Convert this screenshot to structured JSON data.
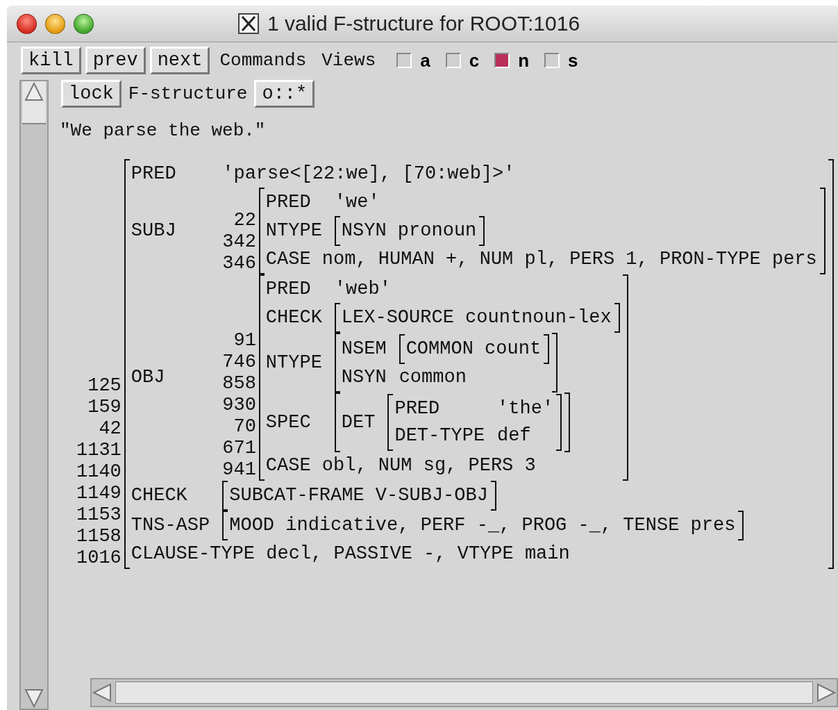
{
  "window": {
    "title": "1 valid F-structure for ROOT:1016"
  },
  "toolbar": {
    "buttons": [
      "kill",
      "prev",
      "next"
    ],
    "menus": [
      "Commands",
      "Views"
    ],
    "views": [
      {
        "label": "a",
        "checked": false
      },
      {
        "label": "c",
        "checked": false
      },
      {
        "label": "n",
        "checked": true
      },
      {
        "label": "s",
        "checked": false
      }
    ]
  },
  "panel": {
    "lock_button": "lock",
    "label": "F-structure",
    "filter_button": "o::*",
    "sentence": "\"We parse the web.\"",
    "fstructure": {
      "ids": [
        "125",
        "159",
        "42",
        "1131",
        "1140",
        "1149",
        "1153",
        "1158",
        "1016"
      ],
      "rows": [
        {
          "kind": "pair",
          "attr": "PRED",
          "value": "'parse<[22:we], [70:web]>'"
        },
        {
          "kind": "sub",
          "attr": "SUBJ",
          "avm": {
            "ids": [
              "22",
              "342",
              "346"
            ],
            "rows": [
              {
                "kind": "pair",
                "attr": "PRED",
                "value": "'we'"
              },
              {
                "kind": "sub",
                "attr": "NTYPE",
                "avm": {
                  "rows": [
                    {
                      "kind": "flat",
                      "text": "NSYN pronoun"
                    }
                  ]
                }
              },
              {
                "kind": "flat",
                "text": "CASE nom, HUMAN +, NUM pl, PERS 1, PRON-TYPE pers"
              }
            ]
          }
        },
        {
          "kind": "sub",
          "attr": "OBJ",
          "avm": {
            "ids": [
              "91",
              "746",
              "858",
              "930",
              "70",
              "671",
              "941"
            ],
            "rows": [
              {
                "kind": "pair",
                "attr": "PRED",
                "value": "'web'"
              },
              {
                "kind": "sub",
                "attr": "CHECK",
                "avm": {
                  "rows": [
                    {
                      "kind": "flat",
                      "text": "LEX-SOURCE countnoun-lex"
                    }
                  ]
                }
              },
              {
                "kind": "sub",
                "attr": "NTYPE",
                "avm": {
                  "rows": [
                    {
                      "kind": "sub",
                      "attr": "NSEM",
                      "avm": {
                        "rows": [
                          {
                            "kind": "flat",
                            "text": "COMMON count"
                          }
                        ]
                      }
                    },
                    {
                      "kind": "pair",
                      "attr": "NSYN",
                      "value": "common"
                    }
                  ]
                }
              },
              {
                "kind": "sub",
                "attr": "SPEC",
                "avm": {
                  "rows": [
                    {
                      "kind": "sub",
                      "attr": "DET",
                      "avm": {
                        "rows": [
                          {
                            "kind": "pair",
                            "attr": "PRED",
                            "value": "'the'"
                          },
                          {
                            "kind": "pair",
                            "attr": "DET-TYPE",
                            "value": "def"
                          }
                        ]
                      }
                    }
                  ]
                }
              },
              {
                "kind": "flat",
                "text": "CASE obl, NUM sg, PERS 3"
              }
            ]
          }
        },
        {
          "kind": "sub",
          "attr": "CHECK",
          "avm": {
            "rows": [
              {
                "kind": "flat",
                "text": "SUBCAT-FRAME V-SUBJ-OBJ"
              }
            ]
          }
        },
        {
          "kind": "sub",
          "attr": "TNS-ASP",
          "avm": {
            "rows": [
              {
                "kind": "flat",
                "text": "MOOD indicative, PERF -_, PROG -_, TENSE pres"
              }
            ]
          }
        },
        {
          "kind": "flat",
          "text": "CLAUSE-TYPE decl, PASSIVE -, VTYPE main"
        }
      ]
    }
  }
}
